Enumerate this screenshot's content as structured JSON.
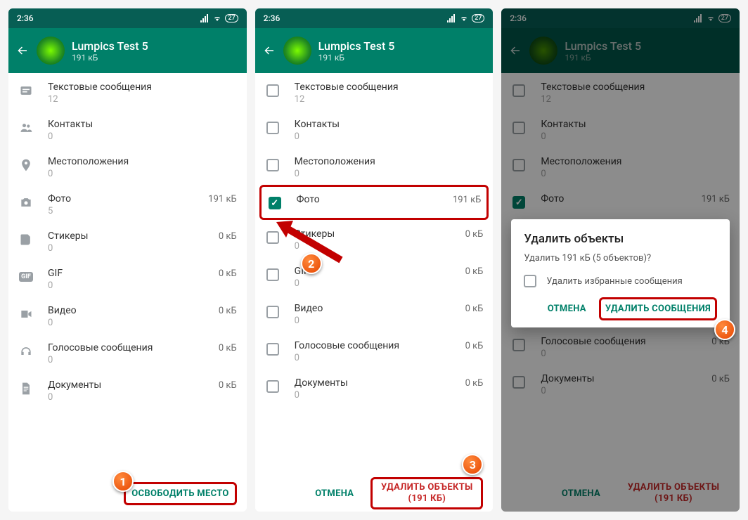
{
  "status": {
    "time": "2:36",
    "battery": "27"
  },
  "contact": {
    "name": "Lumpics Test 5",
    "size": "191 кБ"
  },
  "categories": [
    {
      "id": "text",
      "label": "Текстовые сообщения",
      "count": "12",
      "size": ""
    },
    {
      "id": "contacts",
      "label": "Контакты",
      "count": "0",
      "size": ""
    },
    {
      "id": "location",
      "label": "Местоположения",
      "count": "0",
      "size": ""
    },
    {
      "id": "photo",
      "label": "Фото",
      "count": "5",
      "size": "191 кБ"
    },
    {
      "id": "stickers",
      "label": "Стикеры",
      "count": "0",
      "size": "0 кБ"
    },
    {
      "id": "gif",
      "label": "GIF",
      "count": "0",
      "size": "0 кБ"
    },
    {
      "id": "video",
      "label": "Видео",
      "count": "0",
      "size": "0 кБ"
    },
    {
      "id": "voice",
      "label": "Голосовые сообщения",
      "count": "0",
      "size": "0 кБ"
    },
    {
      "id": "docs",
      "label": "Документы",
      "count": "0",
      "size": "0 кБ"
    }
  ],
  "footer": {
    "free_space": "ОСВОБОДИТЬ МЕСТО",
    "cancel": "ОТМЕНА",
    "delete_objects": "УДАЛИТЬ ОБЪЕКТЫ (191 КБ)"
  },
  "dialog": {
    "title": "Удалить объекты",
    "message": "Удалить 191 кБ (5 объектов)?",
    "starred_label": "Удалить избранные сообщения",
    "cancel": "ОТМЕНА",
    "confirm": "УДАЛИТЬ СООБЩЕНИЯ"
  },
  "steps": {
    "s1": "1",
    "s2": "2",
    "s3": "3",
    "s4": "4"
  }
}
